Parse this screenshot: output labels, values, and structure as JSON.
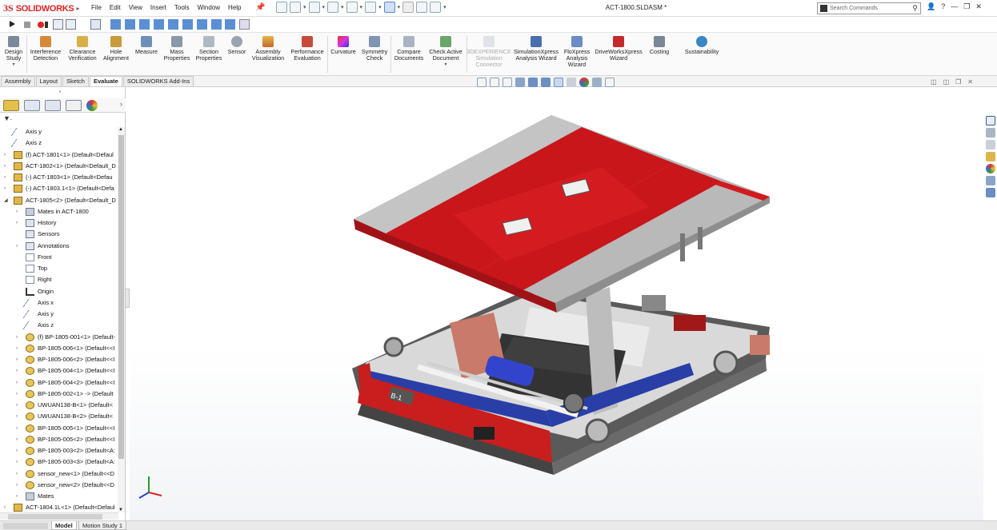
{
  "app": {
    "brand_ds": "3S",
    "brand_name": "SOLIDWORKS",
    "document_title": "ACT-1800.SLDASM *"
  },
  "menu": [
    "File",
    "Edit",
    "View",
    "Insert",
    "Tools",
    "Window",
    "Help"
  ],
  "search": {
    "placeholder": "Search Commands"
  },
  "ribbon": [
    {
      "label": "Design\nStudy",
      "icon": "design-study-icon",
      "enabled": true
    },
    {
      "label": "Interference\nDetection",
      "icon": "interference-icon",
      "enabled": true
    },
    {
      "label": "Clearance\nVerification",
      "icon": "clearance-icon",
      "enabled": true
    },
    {
      "label": "Hole\nAlignment",
      "icon": "hole-alignment-icon",
      "enabled": true
    },
    {
      "label": "Measure",
      "icon": "measure-icon",
      "enabled": true
    },
    {
      "label": "Mass\nProperties",
      "icon": "mass-properties-icon",
      "enabled": true
    },
    {
      "label": "Section\nProperties",
      "icon": "section-properties-icon",
      "enabled": true
    },
    {
      "label": "Sensor",
      "icon": "sensor-icon",
      "enabled": true
    },
    {
      "label": "Assembly\nVisualization",
      "icon": "assembly-visualization-icon",
      "enabled": true
    },
    {
      "label": "Performance\nEvaluation",
      "icon": "performance-icon",
      "enabled": true
    },
    {
      "label": "Curvature",
      "icon": "curvature-icon",
      "enabled": true
    },
    {
      "label": "Symmetry\nCheck",
      "icon": "symmetry-icon",
      "enabled": true
    },
    {
      "label": "Compare\nDocuments",
      "icon": "compare-icon",
      "enabled": true
    },
    {
      "label": "Check Active\nDocument",
      "icon": "check-document-icon",
      "enabled": true
    },
    {
      "label": "3DEXPERIENCE\nSimulation\nConnector",
      "icon": "simulation-connector-icon",
      "enabled": false
    },
    {
      "label": "SimulationXpress\nAnalysis Wizard",
      "icon": "simulationxpress-icon",
      "enabled": true
    },
    {
      "label": "FloXpress\nAnalysis\nWizard",
      "icon": "floxpress-icon",
      "enabled": true
    },
    {
      "label": "DriveWorksXpress\nWizard",
      "icon": "driveworks-icon",
      "enabled": true
    },
    {
      "label": "Costing",
      "icon": "costing-icon",
      "enabled": true
    },
    {
      "label": "Sustainability",
      "icon": "sustainability-icon",
      "enabled": true
    }
  ],
  "tabs": [
    {
      "label": "Assembly",
      "active": false
    },
    {
      "label": "Layout",
      "active": false
    },
    {
      "label": "Sketch",
      "active": false
    },
    {
      "label": "Evaluate",
      "active": true
    },
    {
      "label": "SOLIDWORKS Add-Ins",
      "active": false
    }
  ],
  "tree": [
    {
      "text": "Axis y",
      "level": 0,
      "icon": "axis",
      "expand": false
    },
    {
      "text": "Axis z",
      "level": 0,
      "icon": "axis",
      "expand": false
    },
    {
      "text": "(f) ACT-1801<1> (Default<Defaul",
      "level": 0,
      "icon": "assembly",
      "expand": true
    },
    {
      "text": "ACT-1802<1> (Default<Default_D",
      "level": 0,
      "icon": "assembly",
      "expand": true
    },
    {
      "text": "(-) ACT-1803<1> (Default<Defau",
      "level": 0,
      "icon": "assembly",
      "expand": true
    },
    {
      "text": "(-) ACT-1803.1<1> (Default<Defa",
      "level": 0,
      "icon": "assembly",
      "expand": true
    },
    {
      "text": "ACT-1805<2> (Default<Default_D",
      "level": 0,
      "icon": "assembly",
      "expand": "open"
    },
    {
      "text": "Mates in ACT-1800",
      "level": 1,
      "icon": "mates",
      "expand": true
    },
    {
      "text": "History",
      "level": 1,
      "icon": "history",
      "expand": true
    },
    {
      "text": "Sensors",
      "level": 1,
      "icon": "sensors",
      "expand": false
    },
    {
      "text": "Annotations",
      "level": 1,
      "icon": "annotations",
      "expand": true
    },
    {
      "text": "Front",
      "level": 1,
      "icon": "plane",
      "expand": false
    },
    {
      "text": "Top",
      "level": 1,
      "icon": "plane",
      "expand": false
    },
    {
      "text": "Right",
      "level": 1,
      "icon": "plane",
      "expand": false
    },
    {
      "text": "Origin",
      "level": 1,
      "icon": "origin",
      "expand": false
    },
    {
      "text": "Axis x",
      "level": 1,
      "icon": "axis",
      "expand": false
    },
    {
      "text": "Axis y",
      "level": 1,
      "icon": "axis",
      "expand": false
    },
    {
      "text": "Axis z",
      "level": 1,
      "icon": "axis",
      "expand": false
    },
    {
      "text": "(f) BP-1805-001<1> (Default-",
      "level": 1,
      "icon": "part",
      "expand": true
    },
    {
      "text": "BP-1805-006<1> (Default<<I",
      "level": 1,
      "icon": "part",
      "expand": true
    },
    {
      "text": "BP-1805-006<2> (Default<<I",
      "level": 1,
      "icon": "part",
      "expand": true
    },
    {
      "text": "BP-1805-004<1> (Default<<I",
      "level": 1,
      "icon": "part",
      "expand": true
    },
    {
      "text": "BP-1805-004<2> (Default<<I",
      "level": 1,
      "icon": "part",
      "expand": true
    },
    {
      "text": "BP-1805-002<1> -> (Default",
      "level": 1,
      "icon": "part",
      "expand": true
    },
    {
      "text": "UWUAN138-B<1> (Default<",
      "level": 1,
      "icon": "part",
      "expand": true
    },
    {
      "text": "UWUAN138-B<2> (Default<",
      "level": 1,
      "icon": "part",
      "expand": true
    },
    {
      "text": "BP-1805-005<1> (Default<<I",
      "level": 1,
      "icon": "part",
      "expand": true
    },
    {
      "text": "BP-1805-005<2> (Default<<I",
      "level": 1,
      "icon": "part",
      "expand": true
    },
    {
      "text": "BP-1805-003<2> (Default<A:",
      "level": 1,
      "icon": "part",
      "expand": true
    },
    {
      "text": "BP-1805-003<3> (Default<A:",
      "level": 1,
      "icon": "part",
      "expand": true
    },
    {
      "text": "sensor_new<1> (Default<<D",
      "level": 1,
      "icon": "part",
      "expand": true
    },
    {
      "text": "sensor_new<2> (Default<<D",
      "level": 1,
      "icon": "part",
      "expand": true
    },
    {
      "text": "Mates",
      "level": 1,
      "icon": "mates",
      "expand": true
    },
    {
      "text": "ACT-1804.1L<1> (Default<Defaul",
      "level": 0,
      "icon": "assembly",
      "expand": true
    }
  ],
  "bottom_tabs": [
    {
      "label": "Model",
      "active": true
    },
    {
      "label": "Motion Study 1",
      "active": false
    }
  ],
  "colors": {
    "accent_red": "#d31f1f",
    "brand_red": "#dd2222",
    "selection_blue": "#c8d8ec",
    "frame_blue": "#2233aa"
  }
}
